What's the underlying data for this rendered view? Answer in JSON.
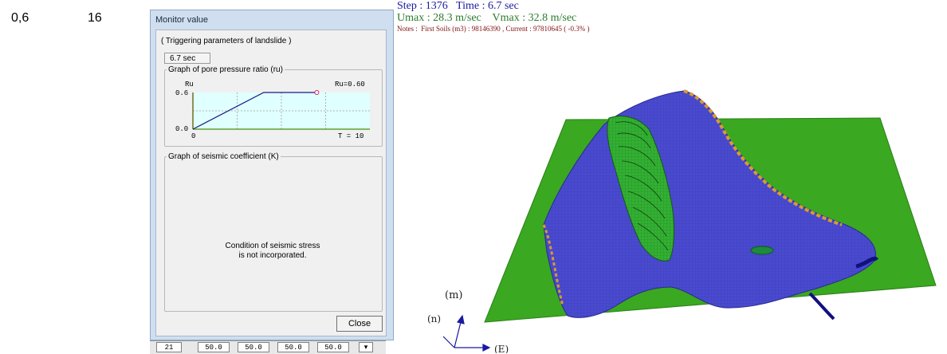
{
  "side": {
    "left_value": "0,6",
    "right_value": "16"
  },
  "window": {
    "title": "Monitor value",
    "subtitle": "( Triggering parameters of landslide )",
    "time_value": "6.7 sec",
    "pore_group": {
      "legend": "Graph of pore pressure ratio (ru)",
      "y_axis_label": "Ru",
      "y_tick_top": "0.6",
      "y_tick_bottom": "0.0",
      "x_tick_origin": "0",
      "value_label": "Ru=0.60",
      "t_label": "T = 10"
    },
    "seismic_group": {
      "legend": "Graph of seismic coefficient (K)",
      "note": "Condition of seismic stress\nis not incorporated."
    },
    "close_label": "Close"
  },
  "table": {
    "cells": [
      "21",
      "50.0",
      "50.0",
      "50.0",
      "50.0"
    ]
  },
  "view": {
    "step_line": "Step : 1376   Time : 6.7 sec",
    "velocity_line": "Umax : 28.3 m/sec    Vmax : 32.8 m/sec",
    "notes_line": "Notes :  First Soils (m3) : 98146390 , Current : 97810645 ( -0.3% )"
  },
  "colors": {
    "ground": "#3aa820",
    "soil": "#4848c8",
    "slide": "#30b030",
    "edge": "#d89a30"
  },
  "chart_data": {
    "type": "line",
    "title": "Graph of pore pressure ratio (ru)",
    "xlabel": "T",
    "ylabel": "Ru",
    "x": [
      0,
      4,
      7
    ],
    "y": [
      0.0,
      0.6,
      0.6
    ],
    "xlim": [
      0,
      10
    ],
    "ylim": [
      0,
      0.6
    ],
    "grid": true
  }
}
